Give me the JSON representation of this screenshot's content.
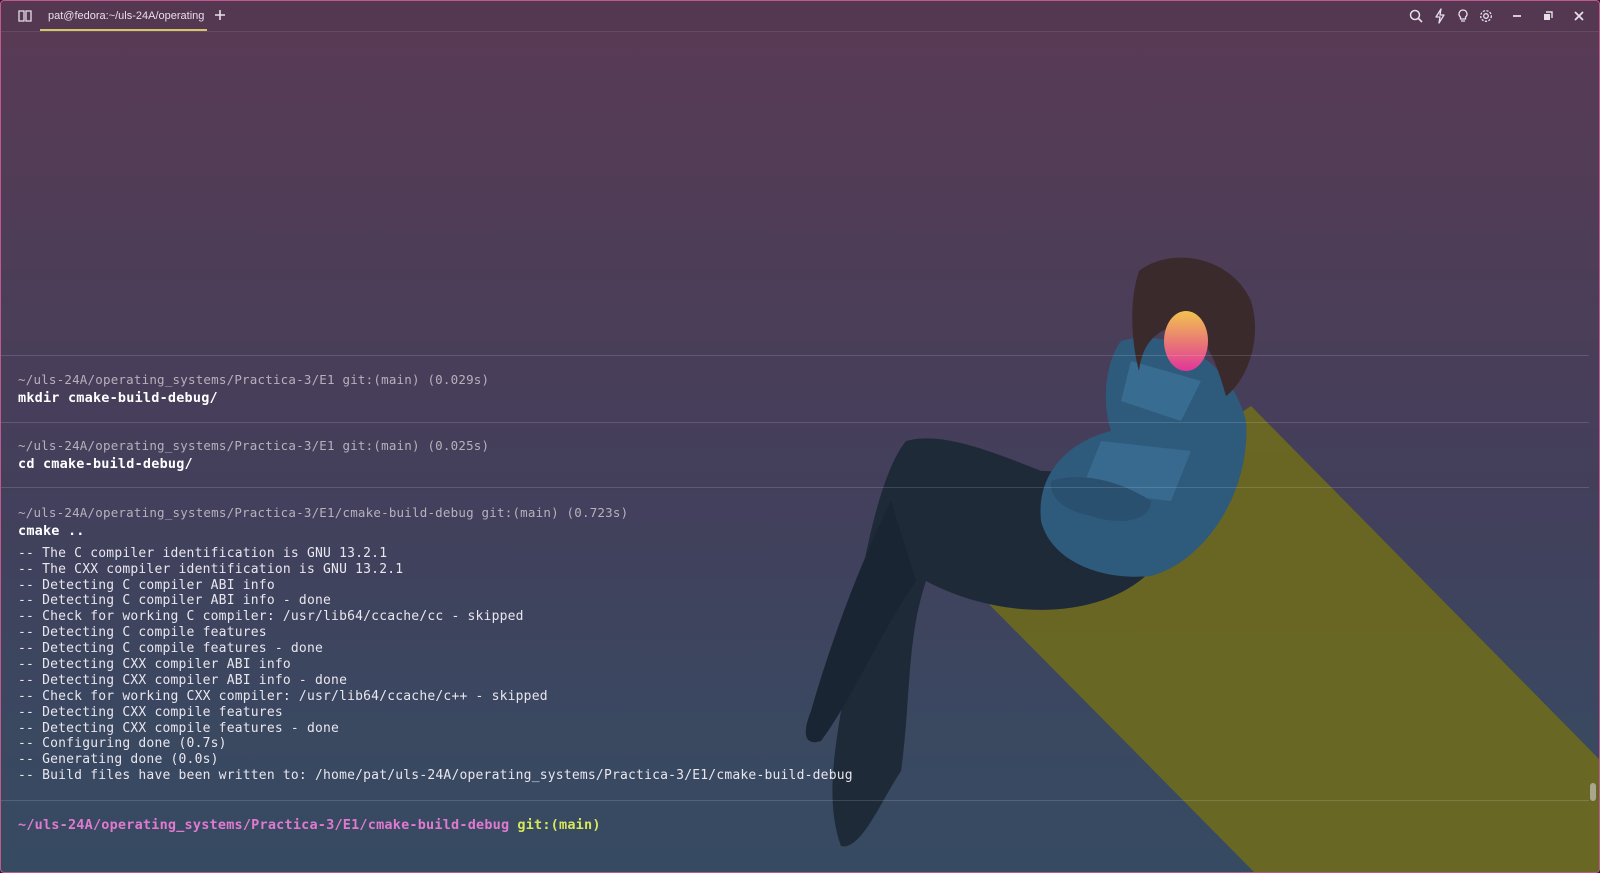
{
  "titlebar": {
    "tab_title": "pat@fedora:~/uls-24A/operating",
    "icons": [
      "sidebar-toggle-icon",
      "plus-icon",
      "search-icon",
      "lightning-icon",
      "lightbulb-icon",
      "gear-icon",
      "minimize-icon",
      "restore-icon",
      "close-icon"
    ]
  },
  "blocks": [
    {
      "meta": "~/uls-24A/operating_systems/Practica-3/E1 git:(main) (0.029s)",
      "command": "mkdir cmake-build-debug/",
      "output": []
    },
    {
      "meta": "~/uls-24A/operating_systems/Practica-3/E1 git:(main) (0.025s)",
      "command": "cd cmake-build-debug/",
      "output": []
    },
    {
      "meta": "~/uls-24A/operating_systems/Practica-3/E1/cmake-build-debug git:(main) (0.723s)",
      "command": "cmake ..",
      "output": [
        "-- The C compiler identification is GNU 13.2.1",
        "-- The CXX compiler identification is GNU 13.2.1",
        "-- Detecting C compiler ABI info",
        "-- Detecting C compiler ABI info - done",
        "-- Check for working C compiler: /usr/lib64/ccache/cc - skipped",
        "-- Detecting C compile features",
        "-- Detecting C compile features - done",
        "-- Detecting CXX compiler ABI info",
        "-- Detecting CXX compiler ABI info - done",
        "-- Check for working CXX compiler: /usr/lib64/ccache/c++ - skipped",
        "-- Detecting CXX compile features",
        "-- Detecting CXX compile features - done",
        "-- Configuring done (0.7s)",
        "-- Generating done (0.0s)",
        "-- Build files have been written to: /home/pat/uls-24A/operating_systems/Practica-3/E1/cmake-build-debug"
      ]
    }
  ],
  "prompt": {
    "path": "~/uls-24A/operating_systems/Practica-3/E1/cmake-build-debug",
    "git": "git:(main)"
  },
  "colors": {
    "accent_tab_underline": "#d6c66a",
    "prompt_path": "#e07ad0",
    "prompt_git": "#d7e85a",
    "window_border": "#c2598e"
  }
}
